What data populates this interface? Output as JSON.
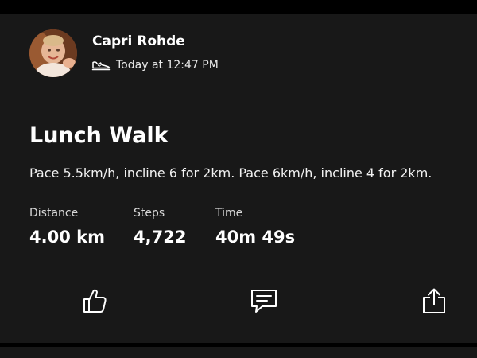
{
  "athlete": {
    "name": "Capri Rohde",
    "timestamp": "Today at 12:47 PM",
    "activity_icon": "walking-shoe-icon"
  },
  "activity": {
    "title": "Lunch Walk",
    "description": "Pace 5.5km/h, incline 6 for 2km. Pace 6km/h, incline 4 for 2km."
  },
  "stats": [
    {
      "label": "Distance",
      "value": "4.00 km"
    },
    {
      "label": "Steps",
      "value": "4,722"
    },
    {
      "label": "Time",
      "value": "40m 49s"
    }
  ],
  "actions": {
    "kudos_icon": "thumbs-up-icon",
    "comment_icon": "comment-icon",
    "share_icon": "share-icon"
  },
  "colors": {
    "background": "#000000",
    "card": "#181818",
    "text": "#ffffff"
  }
}
